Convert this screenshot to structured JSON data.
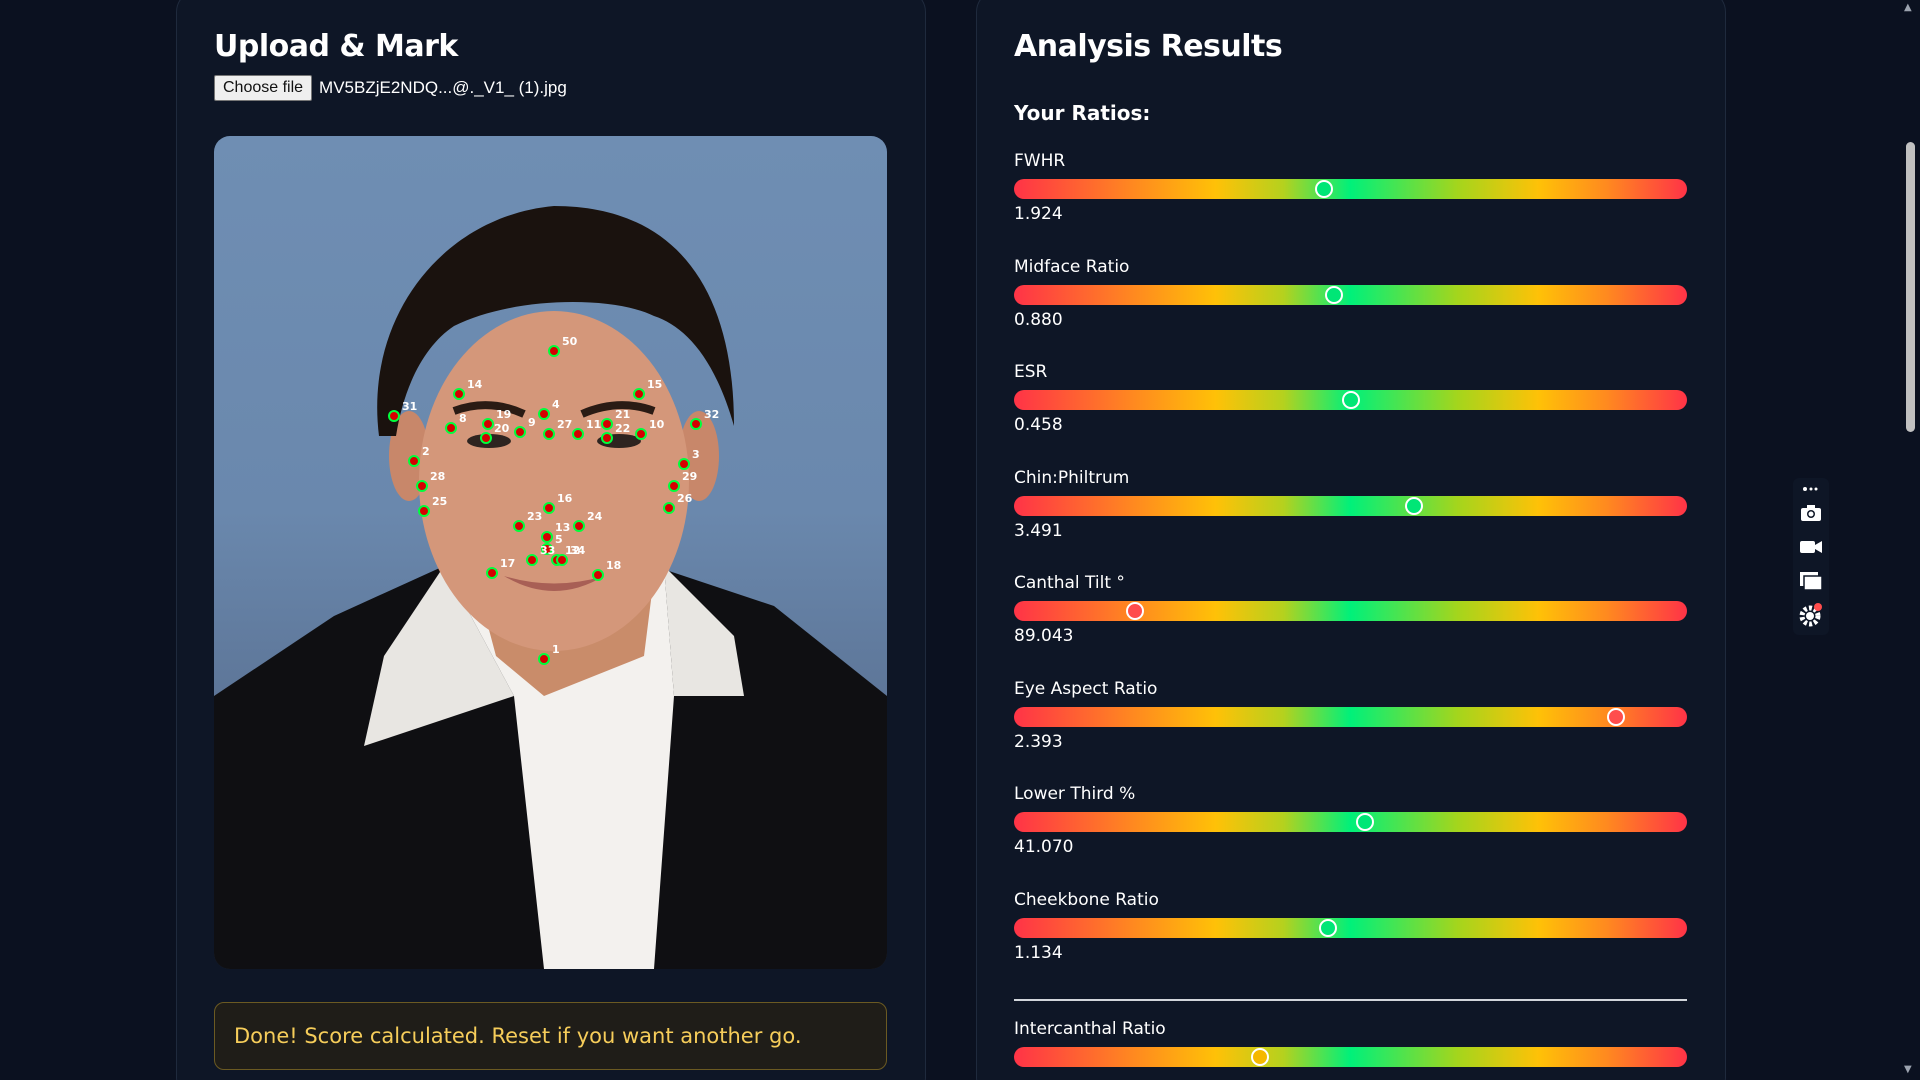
{
  "left_panel": {
    "title": "Upload & Mark",
    "choose_file_label": "Choose file",
    "file_name": "MV5BZjE2NDQ...@._V1_ (1).jpg",
    "status_message": "Done! Score calculated. Reset if you want another go."
  },
  "landmarks": [
    {
      "label": "50"
    },
    {
      "label": "14"
    },
    {
      "label": "15"
    },
    {
      "label": "31"
    },
    {
      "label": "32"
    },
    {
      "label": "4"
    },
    {
      "label": "8"
    },
    {
      "label": "19"
    },
    {
      "label": "20"
    },
    {
      "label": "9"
    },
    {
      "label": "27"
    },
    {
      "label": "11"
    },
    {
      "label": "21"
    },
    {
      "label": "22"
    },
    {
      "label": "10"
    },
    {
      "label": "2"
    },
    {
      "label": "3"
    },
    {
      "label": "28"
    },
    {
      "label": "29"
    },
    {
      "label": "25"
    },
    {
      "label": "26"
    },
    {
      "label": "16"
    },
    {
      "label": "23"
    },
    {
      "label": "24"
    },
    {
      "label": "13"
    },
    {
      "label": "5"
    },
    {
      "label": "33"
    },
    {
      "label": "12"
    },
    {
      "label": "34"
    },
    {
      "label": "17"
    },
    {
      "label": "18"
    },
    {
      "label": "1"
    }
  ],
  "right_panel": {
    "title": "Analysis Results",
    "subtitle": "Your Ratios:",
    "ratios": [
      {
        "label": "FWHR",
        "value": "1.924",
        "position": 0.46,
        "status": "good"
      },
      {
        "label": "Midface Ratio",
        "value": "0.880",
        "position": 0.475,
        "status": "good"
      },
      {
        "label": "ESR",
        "value": "0.458",
        "position": 0.5,
        "status": "good"
      },
      {
        "label": "Chin:Philtrum",
        "value": "3.491",
        "position": 0.595,
        "status": "good"
      },
      {
        "label": "Canthal Tilt °",
        "value": "89.043",
        "position": 0.18,
        "status": "bad"
      },
      {
        "label": "Eye Aspect Ratio",
        "value": "2.393",
        "position": 0.895,
        "status": "bad"
      },
      {
        "label": "Lower Third %",
        "value": "41.070",
        "position": 0.522,
        "status": "good"
      },
      {
        "label": "Cheekbone Ratio",
        "value": "1.134",
        "position": 0.467,
        "status": "good"
      },
      {
        "label": "Intercanthal Ratio",
        "value": "",
        "position": 0.365,
        "status": "mid"
      }
    ]
  },
  "colors": {
    "good_marker": "#00e676",
    "bad_marker": "#ff4d4d",
    "mid_marker": "#f5b800",
    "status_text": "#f6cd5a"
  },
  "toolbar": {
    "icons": [
      "popout-icon",
      "camera-icon",
      "video-camera-icon",
      "window-icon",
      "settings-icon"
    ]
  }
}
